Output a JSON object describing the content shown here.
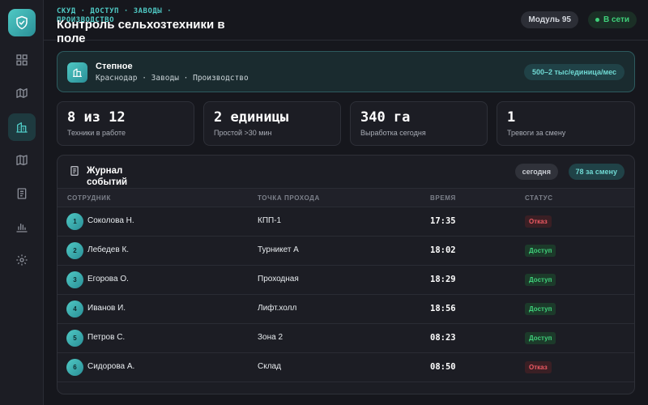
{
  "header": {
    "breadcrumb": "СКУД · ДОСТУП · ЗАВОДЫ · ПРОИЗВОДСТВО",
    "title": "Контроль сельхозтехники в поле",
    "module_badge": "Модуль 95",
    "status_badge": "В сети"
  },
  "sidebar": {
    "items": [
      {
        "icon": "dashboard-icon"
      },
      {
        "icon": "map-icon"
      },
      {
        "icon": "building-icon",
        "active": true
      },
      {
        "icon": "book-icon"
      },
      {
        "icon": "document-icon"
      },
      {
        "icon": "chart-icon"
      },
      {
        "icon": "settings-icon"
      }
    ]
  },
  "location": {
    "name": "Степное",
    "path": "Краснодар · Заводы · Производство",
    "rate": "500–2 тыс/единица/мес"
  },
  "stats": [
    {
      "value": "8 из 12",
      "label": "Техники в работе"
    },
    {
      "value": "2 единицы",
      "label": "Простой >30 мин"
    },
    {
      "value": "340 га",
      "label": "Выработка сегодня"
    },
    {
      "value": "1",
      "label": "Тревоги за смену"
    }
  ],
  "journal": {
    "title": "Журнал событий",
    "filter_today": "сегодня",
    "count": "78 за смену",
    "columns": [
      "СОТРУДНИК",
      "ТОЧКА ПРОХОДА",
      "ВРЕМЯ",
      "СТАТУС"
    ],
    "rows": [
      {
        "num": "1",
        "employee": "Соколова Н.",
        "point": "КПП-1",
        "time": "17:35",
        "status": "Отказ",
        "ok": false
      },
      {
        "num": "2",
        "employee": "Лебедев К.",
        "point": "Турникет А",
        "time": "18:02",
        "status": "Доступ",
        "ok": true
      },
      {
        "num": "3",
        "employee": "Егорова О.",
        "point": "Проходная",
        "time": "18:29",
        "status": "Доступ",
        "ok": true
      },
      {
        "num": "4",
        "employee": "Иванов И.",
        "point": "Лифт.холл",
        "time": "18:56",
        "status": "Доступ",
        "ok": true
      },
      {
        "num": "5",
        "employee": "Петров С.",
        "point": "Зона 2",
        "time": "08:23",
        "status": "Доступ",
        "ok": true
      },
      {
        "num": "6",
        "employee": "Сидорова А.",
        "point": "Склад",
        "time": "08:50",
        "status": "Отказ",
        "ok": false
      }
    ]
  },
  "colors": {
    "accent": "#4fc9c4",
    "ok": "#3fd07a",
    "deny": "#ef5a63",
    "background": "#16171d"
  }
}
